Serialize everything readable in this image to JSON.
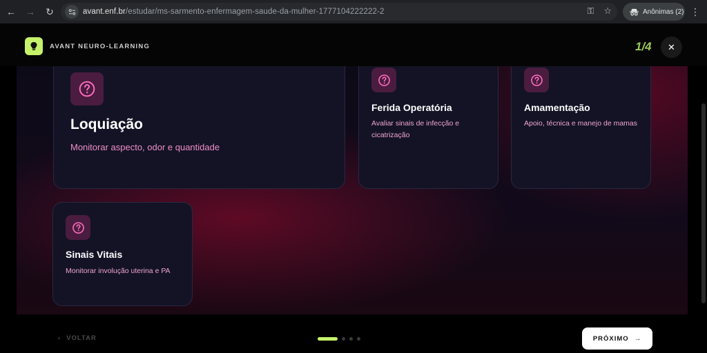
{
  "browser": {
    "url_domain": "avant.enf.br",
    "url_path": "/estudar/ms-sarmento-enfermagem-saude-da-mulher-1777104222222-2",
    "incognito_label": "Anônimas (2)"
  },
  "header": {
    "brand": "AVANT NEURO-LEARNING",
    "progress": "1/4",
    "close_icon": "close-icon"
  },
  "cards": [
    {
      "title": "Loquiação",
      "description": "Monitorar aspecto, odor e quantidade",
      "icon": "question-icon"
    },
    {
      "title": "Ferida Operatória",
      "description": "Avaliar sinais de infecção e cicatrização",
      "icon": "question-icon"
    },
    {
      "title": "Amamentação",
      "description": "Apoio, técnica e manejo de mamas",
      "icon": "question-icon"
    },
    {
      "title": "Sinais Vitais",
      "description": "Monitorar involução uterina e PA",
      "icon": "question-icon"
    }
  ],
  "footer": {
    "back_label": "VOLTAR",
    "next_label": "PRÓXIMO",
    "current_step": 1,
    "total_steps": 4
  },
  "colors": {
    "accent": "#c5f26b",
    "card_bg": "#131325",
    "card_desc": "#f0a5d2",
    "icon_bg": "#4a1c40",
    "icon_stroke": "#ff6fc0"
  }
}
